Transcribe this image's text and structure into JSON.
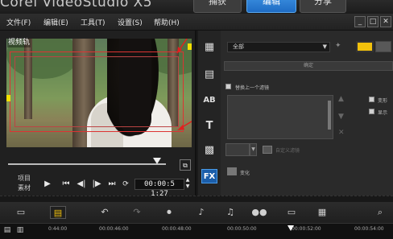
{
  "window": {
    "app_title": "Corel VideoStudio X5",
    "steps": [
      "捕获",
      "编辑",
      "分享"
    ]
  },
  "menu": {
    "items": [
      "文件(F)",
      "编辑(E)",
      "工具(T)",
      "设置(S)",
      "帮助(H)"
    ]
  },
  "preview": {
    "overlay_label": "视频轨",
    "mode_labels": [
      "项目",
      "素材"
    ],
    "timecode": "00:00:5 1:27",
    "marker_color": "#f3e000",
    "selection_color": "#dd3333"
  },
  "tools": [
    "media-icon",
    "instant-project-icon",
    "transition-icon",
    "title-icon",
    "graphic-icon",
    "fx-filter-icon"
  ],
  "tools_fx_label": "FX",
  "options": {
    "gallery_select": "全部",
    "apply_button": "确定",
    "replace_last_filter_label": "替换上一个滤镜",
    "custom_filter_label": "自定义滤镜",
    "variation_label": "变化",
    "right_checks": [
      "变形",
      "显示"
    ],
    "accent": "#f2c10c"
  },
  "timeline": {
    "ruler_ticks": [
      "0:44:00",
      "00:00:46:00",
      "00:00:48:00",
      "00:00:50:00",
      "00:00:52:00",
      "00:00:54:00"
    ]
  }
}
